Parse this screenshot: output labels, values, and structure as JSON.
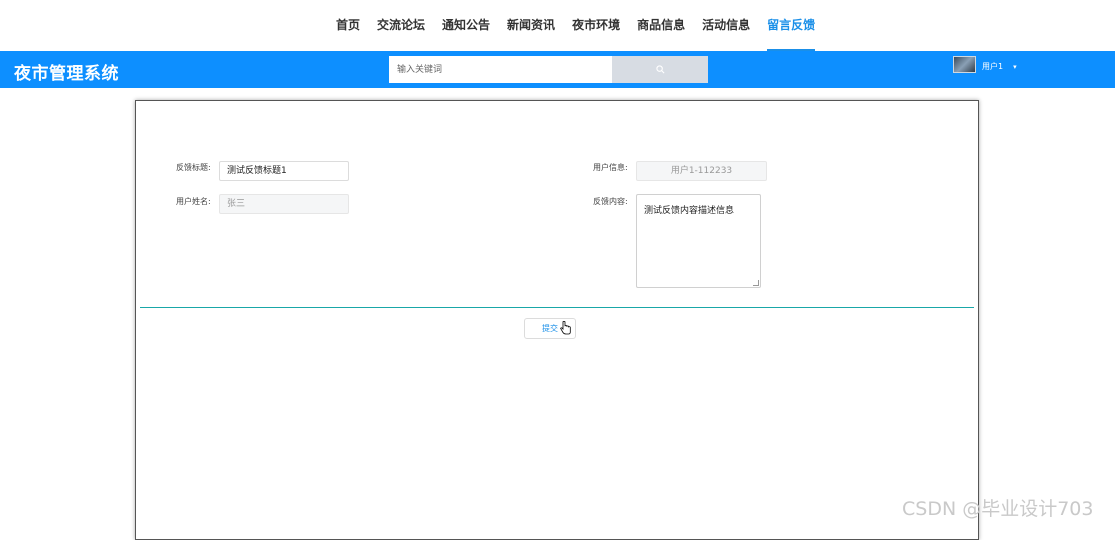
{
  "nav": {
    "items": [
      {
        "label": "首页"
      },
      {
        "label": "交流论坛"
      },
      {
        "label": "通知公告"
      },
      {
        "label": "新闻资讯"
      },
      {
        "label": "夜市环境"
      },
      {
        "label": "商品信息"
      },
      {
        "label": "活动信息"
      },
      {
        "label": "留言反馈",
        "active": true
      }
    ]
  },
  "header": {
    "brand": "夜市管理系统",
    "search_placeholder": "输入关键词",
    "username": "用户1",
    "accent_color": "#0d8fff"
  },
  "form": {
    "title_label": "反馈标题:",
    "title_value": "测试反馈标题1",
    "name_label": "用户姓名:",
    "name_value": "张三",
    "user_info_label": "用户信息:",
    "user_info_value": "用户1-112233",
    "content_label": "反馈内容:",
    "content_value": "测试反馈内容描述信息",
    "submit_label": "提交"
  },
  "watermark": "CSDN @毕业设计703"
}
